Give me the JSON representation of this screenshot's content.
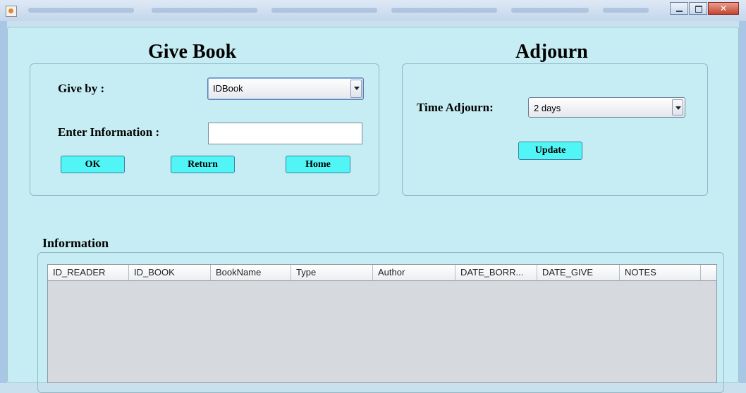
{
  "give_book": {
    "title": "Give Book",
    "give_by_label": "Give by :",
    "give_by_value": "IDBook",
    "enter_info_label": "Enter Information :",
    "enter_info_value": "",
    "ok_label": "OK",
    "return_label": "Return",
    "home_label": "Home"
  },
  "adjourn": {
    "title": "Adjourn",
    "time_label": "Time Adjourn:",
    "time_value": "2 days",
    "update_label": "Update"
  },
  "information": {
    "title": "Information",
    "columns": [
      "ID_READER",
      "ID_BOOK",
      "BookName",
      "Type",
      "Author",
      "DATE_BORR...",
      "DATE_GIVE",
      "NOTES"
    ],
    "rows": []
  },
  "colors": {
    "background": "#c6edf3",
    "button": "#52f5f5",
    "table_body": "#d6d9de"
  },
  "icons": {
    "app": "java-cup-icon",
    "minimize": "minimize-icon",
    "maximize": "maximize-icon",
    "close": "close-icon",
    "dropdown": "chevron-down-icon"
  }
}
